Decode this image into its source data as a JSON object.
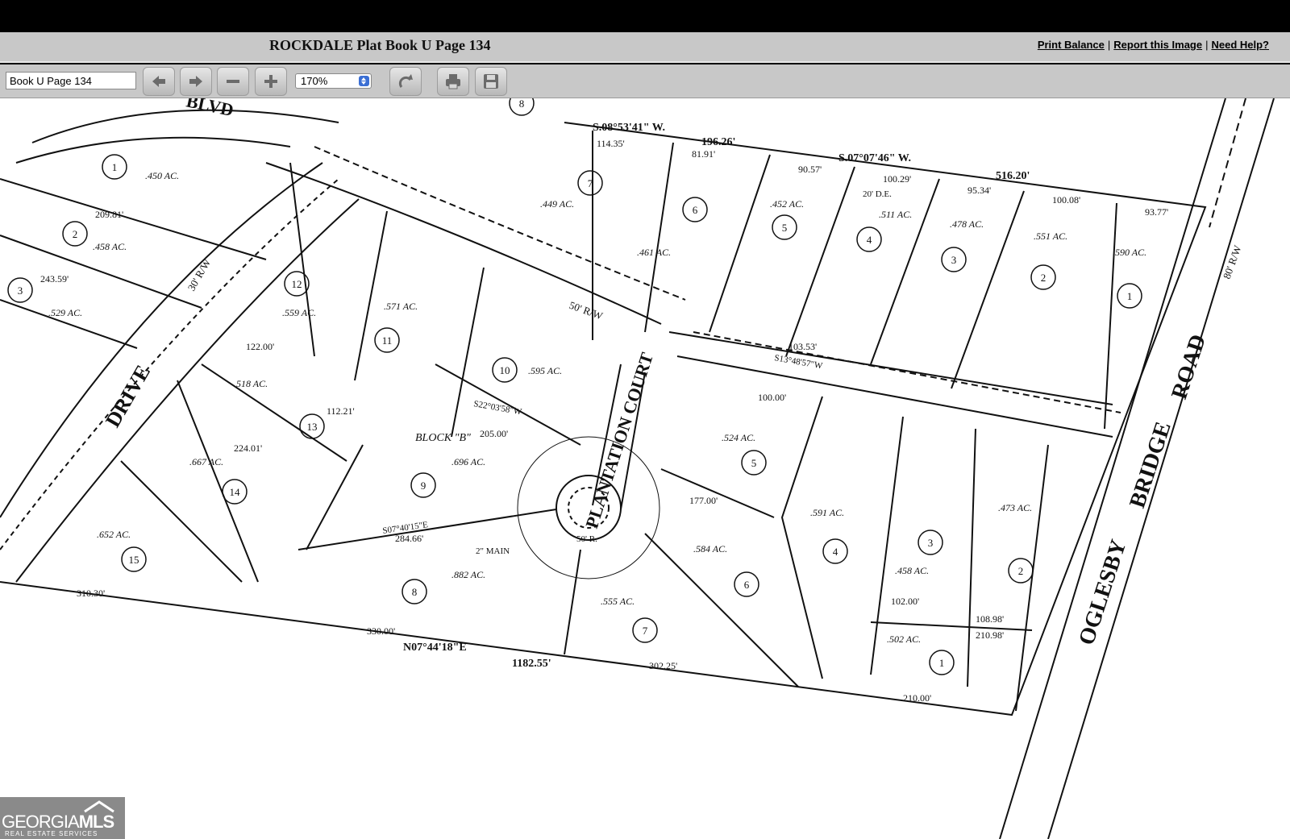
{
  "header": {
    "title": "ROCKDALE Plat Book U Page 134",
    "links": [
      "Print Balance",
      "Report this Image",
      "Need Help?"
    ]
  },
  "toolbar": {
    "page_value": "Book U Page 134",
    "zoom_value": "170%"
  },
  "plat": {
    "roads": [
      "DRIVE",
      "PLANTATION COURT",
      "OGLESBY",
      "BRIDGE",
      "ROAD",
      "BLVD"
    ],
    "block": "BLOCK \"B\"",
    "bearings_top": [
      "S.08°53'41\" W.",
      "196.26'",
      "S.07°07'46\" W.",
      "516.20'"
    ],
    "bearing_bottom": [
      "N07°44'18\"E",
      "1182.55'"
    ],
    "right_of_way": [
      "50' R/W",
      "80' R/W",
      "30' R/W"
    ],
    "lots_top_right": [
      {
        "num": "7",
        "area": ".449 AC."
      },
      {
        "num": "6",
        "area": ".461 AC."
      },
      {
        "num": "5",
        "area": ".452 AC."
      },
      {
        "num": "4",
        "area": ".511 AC."
      },
      {
        "num": "3",
        "area": ".478 AC."
      },
      {
        "num": "2",
        "area": ".551 AC."
      },
      {
        "num": "1",
        "area": ".590 AC."
      }
    ],
    "lots_center": [
      {
        "num": "12",
        "area": ".559 AC."
      },
      {
        "num": "11",
        "area": ".571 AC."
      },
      {
        "num": "10",
        "area": ".595 AC."
      },
      {
        "num": "13",
        "area": ".518 AC."
      },
      {
        "num": "14",
        "area": ".667 AC."
      },
      {
        "num": "9",
        "area": ".696 AC."
      },
      {
        "num": "15",
        "area": ".652 AC."
      },
      {
        "num": "8",
        "area": ".882 AC."
      }
    ],
    "lots_lower_right": [
      {
        "num": "5",
        "area": ".524 AC."
      },
      {
        "num": "6",
        "area": ".584 AC."
      },
      {
        "num": "7",
        "area": ".555 AC."
      },
      {
        "num": "4",
        "area": ".591 AC."
      },
      {
        "num": "3",
        "area": ".458 AC."
      },
      {
        "num": "2",
        "area": ".473 AC."
      },
      {
        "num": "1",
        "area": ".502 AC."
      }
    ],
    "lots_left": [
      {
        "num": "1",
        "area": ".450 AC."
      },
      {
        "num": "2",
        "area": ".458 AC."
      },
      {
        "num": "3",
        "area": ".529 AC."
      }
    ],
    "dimensions": [
      "310.30'",
      "330.00'",
      "302.25'",
      "210.00'",
      "100.00'",
      "177.00'",
      "284.66'",
      "205.00'",
      "224.01'",
      "122.00'",
      "112.21'",
      "209.81'",
      "243.59'",
      "114.35'",
      "81.91'",
      "90.57'",
      "100.29'",
      "95.34'",
      "100.08'",
      "93.77'",
      "103.53'",
      "102.00'",
      "108.98'",
      "210.98'"
    ],
    "labels_misc": [
      "2\" MAIN",
      "50' R.",
      "20' D.E.",
      "S22°03'58\"W",
      "S13°48'57\"W",
      "S07°40'15\"E"
    ]
  },
  "logo": {
    "brand_left": "GEORGIA",
    "brand_right": "MLS",
    "tagline": "REAL ESTATE SERVICES"
  }
}
